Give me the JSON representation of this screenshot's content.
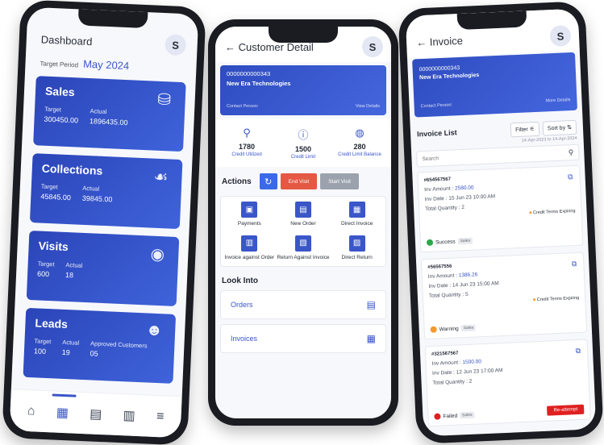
{
  "dashboard": {
    "title": "Dashboard",
    "avatar": "S",
    "target_period_label": "Target Period",
    "target_period_value": "May 2024",
    "cards": [
      {
        "title": "Sales",
        "cols": [
          {
            "k": "Target",
            "v": "300450.00"
          },
          {
            "k": "Actual",
            "v": "1896435.00"
          }
        ],
        "icon": "hand-coins-icon"
      },
      {
        "title": "Collections",
        "cols": [
          {
            "k": "Target",
            "v": "45845.00"
          },
          {
            "k": "Actual",
            "v": "39845.00"
          }
        ],
        "icon": "hand-money-icon"
      },
      {
        "title": "Visits",
        "cols": [
          {
            "k": "Target",
            "v": "600"
          },
          {
            "k": "Actual",
            "v": "18"
          }
        ],
        "icon": "location-pin-icon"
      },
      {
        "title": "Leads",
        "cols": [
          {
            "k": "Target",
            "v": "100"
          },
          {
            "k": "Actual",
            "v": "19"
          },
          {
            "k": "Approved Customers",
            "v": "05"
          }
        ],
        "icon": "people-icon"
      }
    ]
  },
  "customer": {
    "title": "Customer Detail",
    "avatar": "S",
    "number": "0000000000343",
    "name": "New Era Technologies",
    "contact_person": "Contact Person:",
    "view_details": "View Details",
    "credit": [
      {
        "value": "1780",
        "label": "Credit Utilized"
      },
      {
        "value": "1500",
        "label": "Credit Limit"
      },
      {
        "value": "280",
        "label": "Credit Limit Balance"
      }
    ],
    "actions_title": "Actions",
    "end_visit": "End Visit",
    "start_visit": "Start Visit",
    "grid": [
      {
        "label": "Payments",
        "icon": "payments-icon"
      },
      {
        "label": "New Order",
        "icon": "new-order-icon"
      },
      {
        "label": "Direct Invoice",
        "icon": "direct-invoice-icon"
      },
      {
        "label": "Invoice against Order",
        "icon": "invoice-order-icon"
      },
      {
        "label": "Return Against Invoice",
        "icon": "return-invoice-icon"
      },
      {
        "label": "Direct Return",
        "icon": "direct-return-icon"
      }
    ],
    "look_into_title": "Look Into",
    "look_into": [
      {
        "label": "Orders"
      },
      {
        "label": "Invoices"
      }
    ]
  },
  "invoice": {
    "title": "Invoice",
    "avatar": "S",
    "number": "0000000000343",
    "name": "New Era Technologies",
    "contact_person": "Contact Person:",
    "more_details": "More Details",
    "list_title": "Invoice List",
    "filter_label": "Filter",
    "sort_label": "Sort by",
    "date_range": "14-Apr-2023 to 14-Apr-2024",
    "search_placeholder": "Search",
    "items": [
      {
        "id": "#654567567",
        "amount_label": "Inv Amount :",
        "amount": "2580.00",
        "date_label": "Inv Date :",
        "date": "15 Jun 23 10:00 AM",
        "qty_label": "Total Quantity :",
        "qty": "2",
        "tag": "Credit Terms Expiring",
        "status": "Success",
        "chip": "Sales",
        "status_color": "#2aa84a",
        "reattempt": ""
      },
      {
        "id": "#56567556",
        "amount_label": "Inv Amount :",
        "amount": "1386.26",
        "date_label": "Inv Date :",
        "date": "14 Jun 23 15:00 AM",
        "qty_label": "Total Quantity :",
        "qty": "5",
        "tag": "Credit Terms Expiring",
        "status": "Warning",
        "chip": "Sales",
        "status_color": "#f29a2e",
        "reattempt": ""
      },
      {
        "id": "#321567567",
        "amount_label": "Inv Amount :",
        "amount": "1500.00",
        "date_label": "Inv Date :",
        "date": "12 Jun 23 17:00 AM",
        "qty_label": "Total Quantity :",
        "qty": "2",
        "tag": "",
        "status": "Failed",
        "chip": "Sales",
        "status_color": "#e02020",
        "reattempt": "Re-attempt"
      }
    ]
  },
  "bottom_nav": [
    {
      "icon": "home-icon",
      "glyph": "⌂"
    },
    {
      "icon": "grid-icon",
      "glyph": "▦"
    },
    {
      "icon": "building-icon",
      "glyph": "▤"
    },
    {
      "icon": "store-icon",
      "glyph": "▥"
    },
    {
      "icon": "menu-icon",
      "glyph": "≡"
    }
  ]
}
